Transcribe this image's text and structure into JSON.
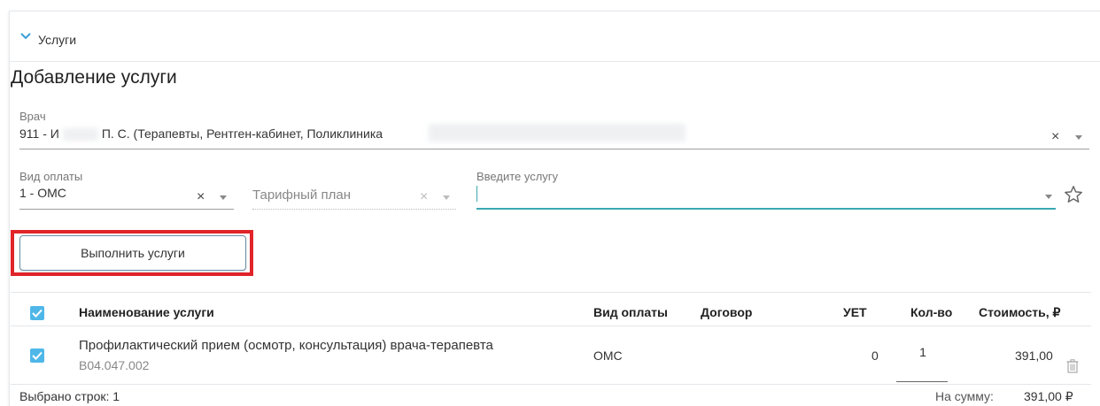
{
  "section": {
    "title": "Услуги"
  },
  "form": {
    "heading": "Добавление услуги",
    "doctor": {
      "label": "Врач",
      "value_prefix": "911 - И",
      "value_rest": "П. С. (Терапевты, Рентген-кабинет, Поликлиника"
    },
    "payment": {
      "label": "Вид оплаты",
      "value": "1 - ОМС"
    },
    "tariff": {
      "placeholder": "Тарифный план"
    },
    "service": {
      "label": "Введите услугу",
      "value": ""
    }
  },
  "actions": {
    "execute_label": "Выполнить услуги"
  },
  "table": {
    "headers": {
      "name": "Наименование услуги",
      "payment": "Вид оплаты",
      "contract": "Договор",
      "uet": "УЕТ",
      "qty": "Кол-во",
      "cost": "Стоимость, ₽"
    },
    "rows": [
      {
        "name": "Профилактический прием (осмотр, консультация) врача-терапевта",
        "code": "B04.047.002",
        "payment": "ОМС",
        "contract": "",
        "uet": "0",
        "qty": "1",
        "cost": "391,00",
        "checked": true
      }
    ]
  },
  "footer": {
    "selected_label": "Выбрано строк: 1",
    "sum_label": "На сумму:",
    "sum_value": "391,00 ₽"
  },
  "colors": {
    "accent": "#3aa8b0",
    "checkbox": "#4fb7e8",
    "highlight": "#e0242a"
  },
  "icons": [
    "chevron-down-icon",
    "close-icon",
    "caret-down-icon",
    "star-icon",
    "check-icon",
    "trash-icon"
  ]
}
